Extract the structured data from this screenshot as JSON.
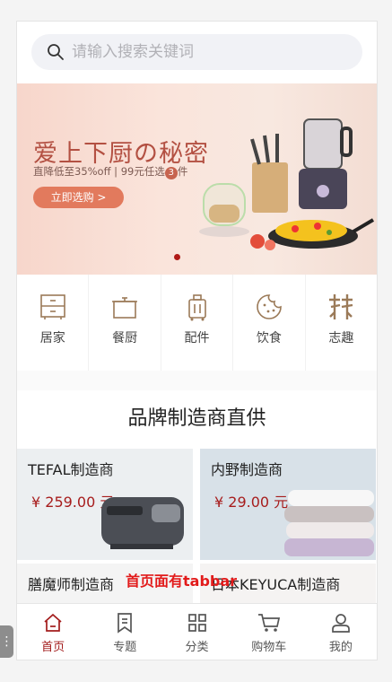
{
  "search": {
    "placeholder": "请输入搜索关键词"
  },
  "banner": {
    "title": "爱上下厨の秘密",
    "subtitle_prefix": "直降低至35%off | 99元任选",
    "subtitle_num": "3",
    "subtitle_suffix": "件",
    "button": "立即选购 >"
  },
  "categories": [
    {
      "label": "居家",
      "icon": "cabinet-icon"
    },
    {
      "label": "餐厨",
      "icon": "pot-icon"
    },
    {
      "label": "配件",
      "icon": "luggage-icon"
    },
    {
      "label": "饮食",
      "icon": "cookie-icon"
    },
    {
      "label": "志趣",
      "icon": "bamboo-icon"
    }
  ],
  "section_title": "品牌制造商直供",
  "brands": [
    {
      "name": "TEFAL制造商",
      "price": "¥ 259.00 元"
    },
    {
      "name": "内野制造商",
      "price": "¥ 29.00 元"
    },
    {
      "name": "膳魔师制造商"
    },
    {
      "name": "日本KEYUCA制造商"
    }
  ],
  "overlay_note": "首页面有tabbar",
  "tabbar": [
    {
      "label": "首页",
      "icon": "home-icon"
    },
    {
      "label": "专题",
      "icon": "bookmark-icon"
    },
    {
      "label": "分类",
      "icon": "grid-icon"
    },
    {
      "label": "购物车",
      "icon": "cart-icon"
    },
    {
      "label": "我的",
      "icon": "user-icon"
    }
  ],
  "colors": {
    "accent": "#a31c1c",
    "banner_button": "#e27a5d"
  }
}
